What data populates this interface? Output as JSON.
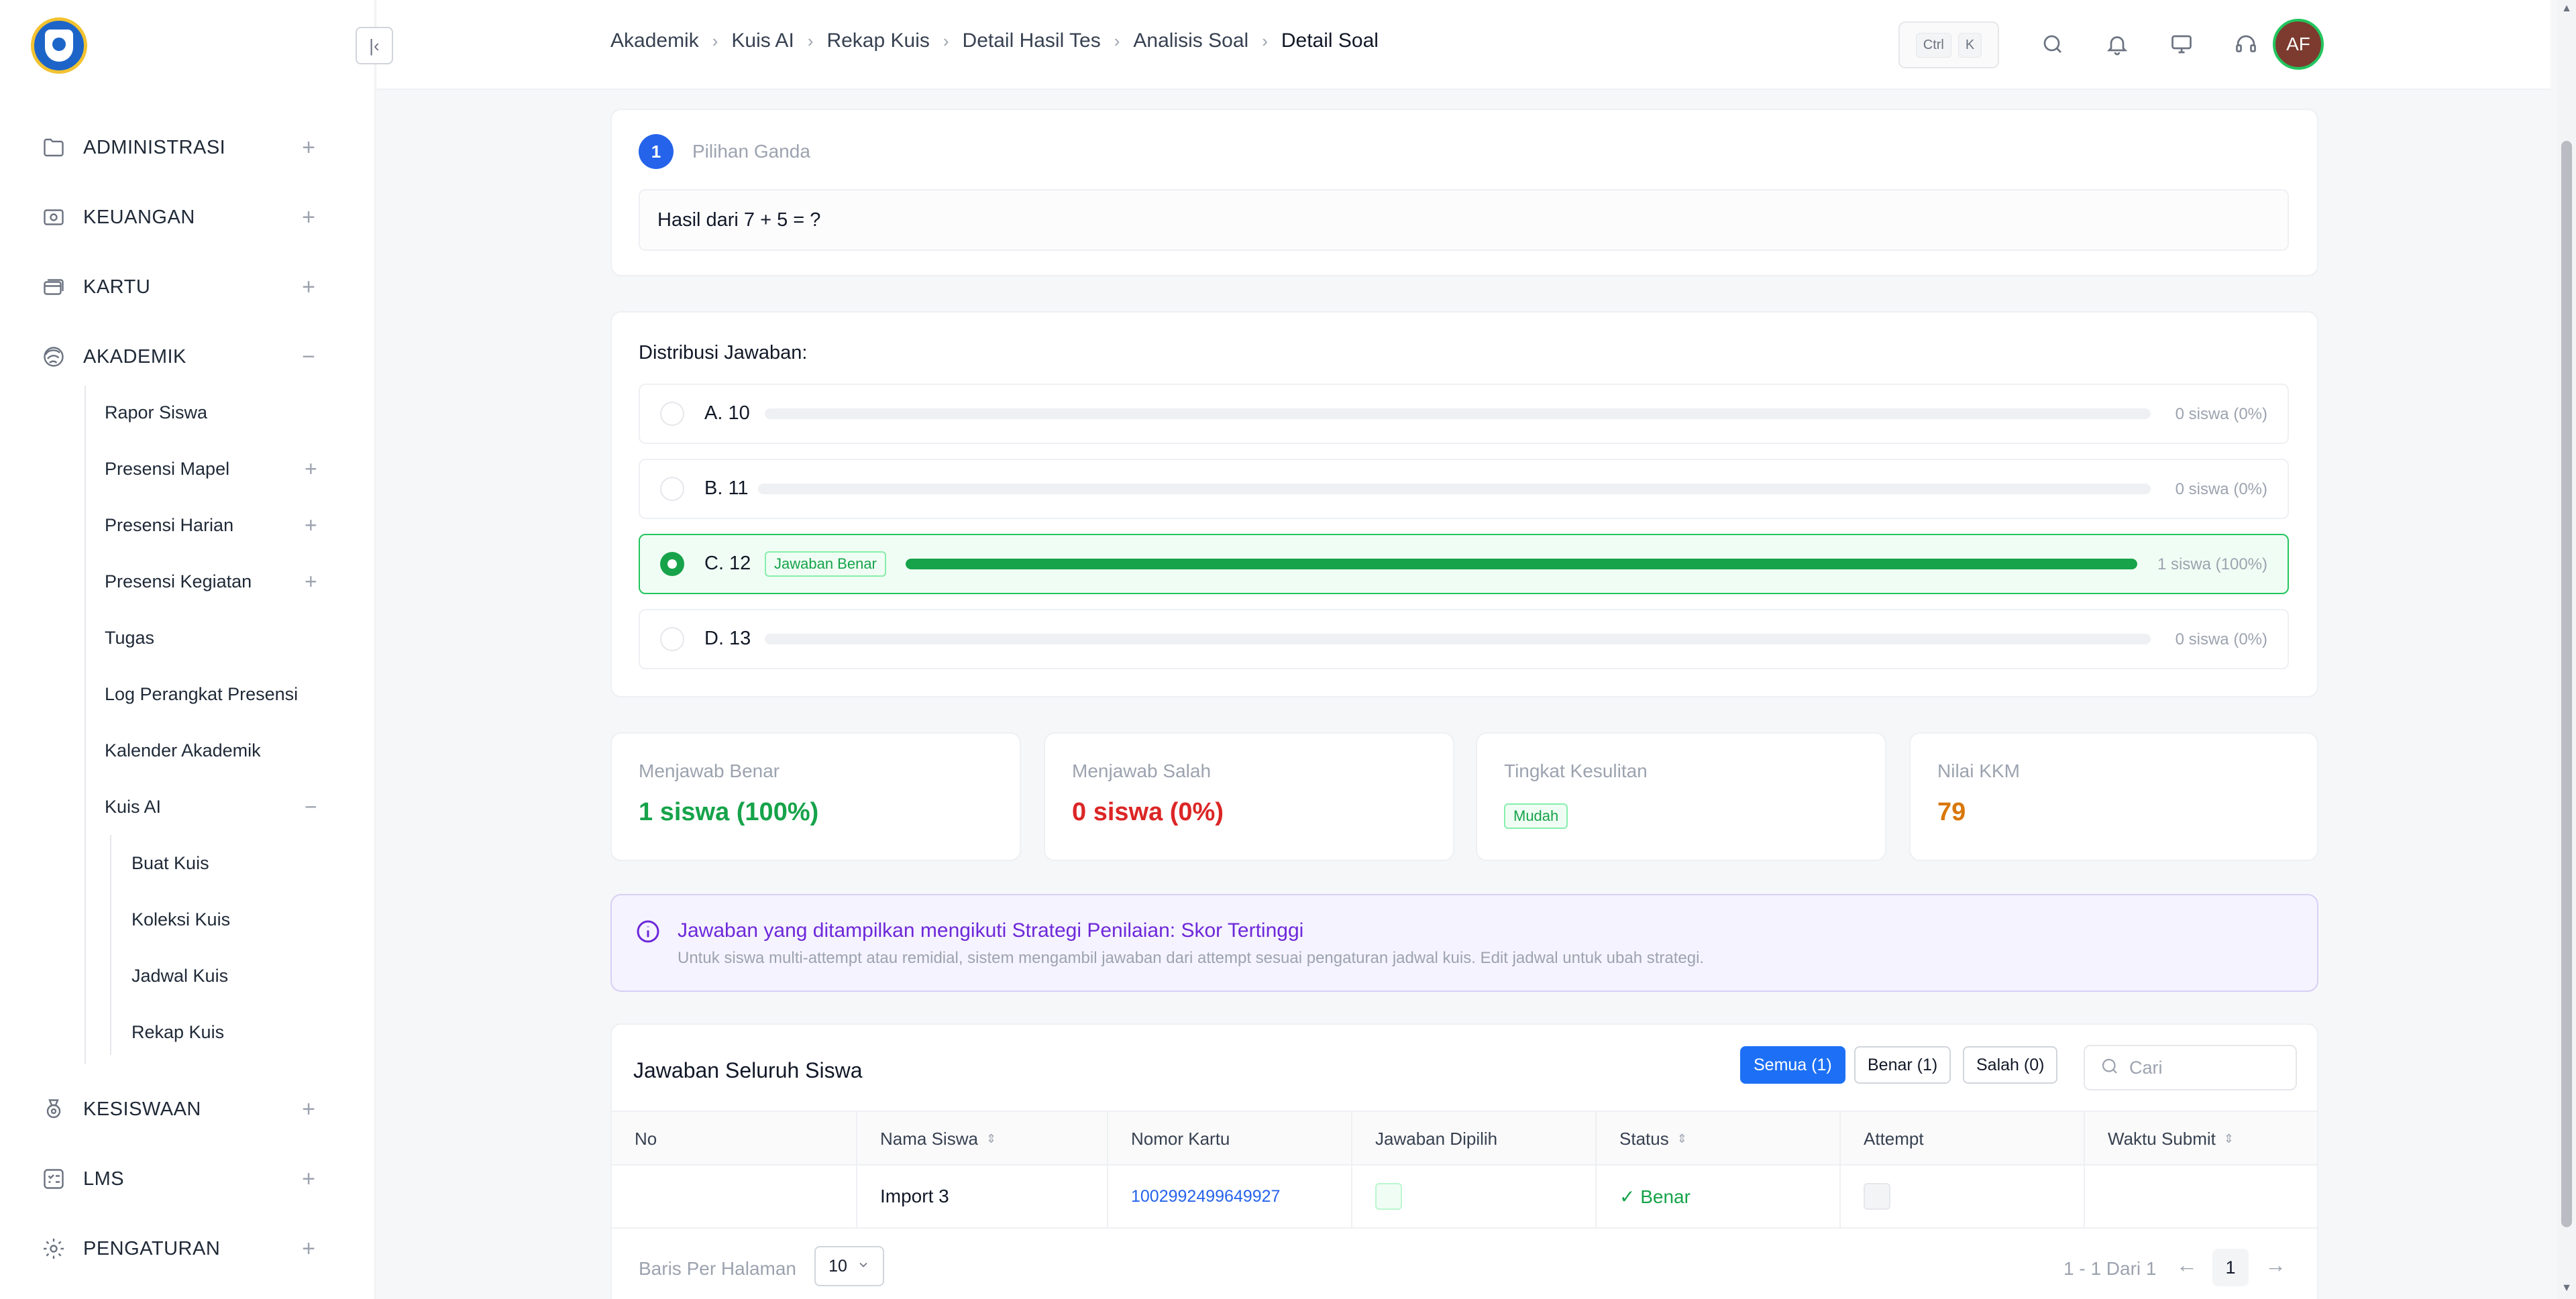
{
  "sidebar": {
    "groups": [
      {
        "label": "ADMINISTRASI",
        "icon": "folder-icon",
        "toggle": "+"
      },
      {
        "label": "KEUANGAN",
        "icon": "money-icon",
        "toggle": "+"
      },
      {
        "label": "KARTU",
        "icon": "card-icon",
        "toggle": "+"
      },
      {
        "label": "AKADEMIK",
        "icon": "graduation-icon",
        "toggle": "−"
      },
      {
        "label": "KESISWAAN",
        "icon": "medal-icon",
        "toggle": "+"
      },
      {
        "label": "LMS",
        "icon": "list-icon",
        "toggle": "+"
      },
      {
        "label": "PENGATURAN",
        "icon": "gear-icon",
        "toggle": "+"
      }
    ],
    "akademik_items": [
      {
        "label": "Rapor Siswa"
      },
      {
        "label": "Presensi Mapel",
        "toggle": "+"
      },
      {
        "label": "Presensi Harian",
        "toggle": "+"
      },
      {
        "label": "Presensi Kegiatan",
        "toggle": "+"
      },
      {
        "label": "Tugas"
      },
      {
        "label": "Log Perangkat Presensi"
      },
      {
        "label": "Kalender Akademik"
      },
      {
        "label": "Kuis AI",
        "toggle": "−"
      }
    ],
    "kuis_items": [
      {
        "label": "Buat Kuis"
      },
      {
        "label": "Koleksi Kuis"
      },
      {
        "label": "Jadwal Kuis"
      },
      {
        "label": "Rekap Kuis"
      }
    ]
  },
  "breadcrumb": [
    "Akademik",
    "Kuis AI",
    "Rekap Kuis",
    "Detail Hasil Tes",
    "Analisis Soal",
    "Detail Soal"
  ],
  "topbar": {
    "kbd_ctrl": "Ctrl",
    "kbd_k": "K",
    "avatar": "AF"
  },
  "question": {
    "number": "1",
    "type": "Pilihan Ganda",
    "text": "Hasil dari 7 + 5 = ?"
  },
  "distribution": {
    "title": "Distribusi Jawaban:",
    "correct_tag": "Jawaban Benar",
    "options": [
      {
        "label": "A. 10",
        "count": "0 siswa (0%)",
        "fraction": 0,
        "correct": false
      },
      {
        "label": "B. 11",
        "count": "0 siswa (0%)",
        "fraction": 0,
        "correct": false
      },
      {
        "label": "C. 12",
        "count": "1 siswa (100%)",
        "fraction": 1,
        "correct": true
      },
      {
        "label": "D. 13",
        "count": "0 siswa (0%)",
        "fraction": 0,
        "correct": false
      }
    ]
  },
  "stats": {
    "correct_label": "Menjawab Benar",
    "correct_value": "1 siswa (100%)",
    "wrong_label": "Menjawab Salah",
    "wrong_value": "0 siswa (0%)",
    "difficulty_label": "Tingkat Kesulitan",
    "difficulty_value": "Mudah",
    "kkm_label": "Nilai KKM",
    "kkm_value": "79"
  },
  "info": {
    "title": "Jawaban yang ditampilkan mengikuti Strategi Penilaian: Skor Tertinggi",
    "desc": "Untuk siswa multi-attempt atau remidial, sistem mengambil jawaban dari attempt sesuai pengaturan jadwal kuis. Edit jadwal untuk ubah strategi."
  },
  "answers": {
    "title": "Jawaban Seluruh Siswa",
    "filters": {
      "all": "Semua (1)",
      "correct": "Benar (1)",
      "wrong": "Salah (0)"
    },
    "search_placeholder": "Cari",
    "columns": {
      "no": "No",
      "name": "Nama Siswa",
      "card": "Nomor Kartu",
      "answer": "Jawaban Dipilih",
      "status": "Status",
      "attempt": "Attempt",
      "submit": "Waktu Submit"
    },
    "rows": [
      {
        "no": "",
        "name": "Import 3",
        "card": "1002992499649927",
        "status": "✓ Benar",
        "submit": ""
      }
    ],
    "pagination": {
      "rows_label": "Baris Per Halaman",
      "rows_value": "10",
      "info": "1 - 1 Dari 1",
      "page": "1"
    }
  },
  "colors": {
    "accent": "#1d70f5",
    "success": "#16a34a",
    "danger": "#dc2626",
    "warning": "#d97706",
    "info": "#6d28d9"
  }
}
